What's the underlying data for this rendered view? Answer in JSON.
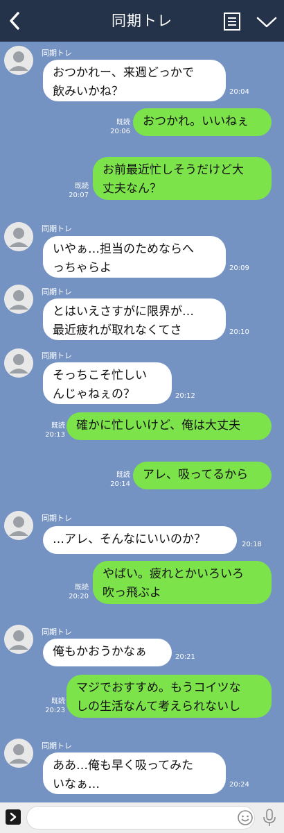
{
  "header": {
    "title": "同期トレ"
  },
  "contact": {
    "name": "同期トレ"
  },
  "read_label": "既読",
  "messages": [
    {
      "from": "in",
      "text": "おつかれー、来週どっかで\n飲みいかね？",
      "time": "20:04"
    },
    {
      "from": "out",
      "text": "おつかれ。いいねぇ",
      "time": "20:06",
      "read": "既読"
    },
    {
      "from": "out",
      "text": "お前最近忙しそうだけど大\n丈夫なん？",
      "time": "20:07",
      "read": "既読"
    },
    {
      "from": "in",
      "text": "いやぁ…担当のためならへ\nっちゃらよ",
      "time": "20:09"
    },
    {
      "from": "in",
      "text": "とはいえさすがに限界が…\n最近疲れが取れなくてさ",
      "time": "20:10"
    },
    {
      "from": "in",
      "text": "そっちこそ忙しい\nんじゃねぇの？",
      "time": "20:12"
    },
    {
      "from": "out",
      "text": "確かに忙しいけど、俺は大丈夫",
      "time": "20:13",
      "read": "既読"
    },
    {
      "from": "out",
      "text": "アレ、吸ってるから",
      "time": "20:14",
      "read": "既読"
    },
    {
      "from": "in",
      "text": "…アレ、そんなにいいのか？",
      "time": "20:18"
    },
    {
      "from": "out",
      "text": "やばい。疲れとかいろいろ\n吹っ飛ぶよ",
      "time": "20:20",
      "read": "既読"
    },
    {
      "from": "in",
      "text": "俺もかおうかなぁ",
      "time": "20:21"
    },
    {
      "from": "out",
      "text": "マジでおすすめ。もうコイツな\nしの生活なんて考えられないし",
      "time": "20:23",
      "read": "既読"
    },
    {
      "from": "in",
      "text": "ああ…俺も早く吸ってみた\nいなぁ…",
      "time": "20:24"
    }
  ],
  "icons": {
    "back": "chevron-left-icon",
    "menu": "notes-icon",
    "collapse": "chevron-down-icon",
    "expand": "chevron-right-icon",
    "emoji": "smiley-icon",
    "mic": "microphone-icon"
  },
  "colors": {
    "header": "#24324a",
    "background": "#7492c2",
    "outgoing_bubble": "#7de34b",
    "incoming_bubble": "#ffffff"
  }
}
